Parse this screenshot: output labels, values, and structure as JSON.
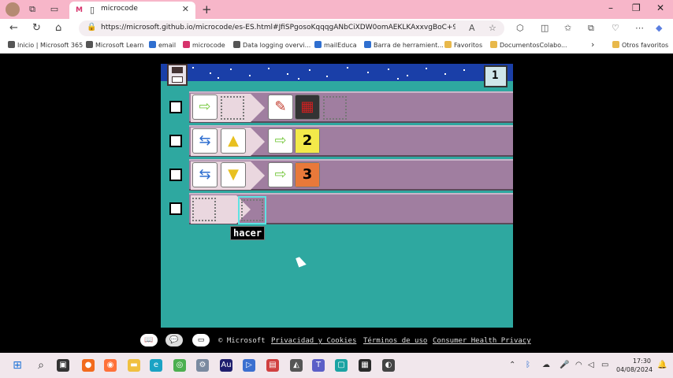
{
  "browser": {
    "tab_title": "microcode",
    "tab_favicon": "M",
    "new_tab": "+",
    "url": "https://microsoft.github.io/microcode/es-ES.html#JfiSPgosoKqqqgANbCiXDW0omAEKLKAxxvgBoC+9EACyn...",
    "window_controls": {
      "minimize": "–",
      "restore": "❐",
      "close": "✕"
    },
    "nav": {
      "back": "←",
      "reload": "↻",
      "home": "⌂"
    },
    "more": "⋯"
  },
  "bookmarks": [
    {
      "label": "Inicio | Microsoft 365",
      "color": "#555555"
    },
    {
      "label": "Microsoft Learn",
      "color": "#555555"
    },
    {
      "label": "email",
      "color": "#2f6fd0"
    },
    {
      "label": "microcode",
      "color": "#d6336c"
    },
    {
      "label": "Data logging overvi...",
      "color": "#555555"
    },
    {
      "label": "mailEduca",
      "color": "#2f6fd0"
    },
    {
      "label": "Barra de herramient...",
      "color": "#2f6fd0"
    },
    {
      "label": "Favoritos",
      "color": "#e8b84a"
    },
    {
      "label": "DocumentosColabo...",
      "color": "#e8b84a"
    },
    {
      "label": "Otros favoritos",
      "color": "#e8b84a"
    }
  ],
  "bookmarks_more": "›",
  "editor": {
    "page_number": "1",
    "tooltip": "hacer",
    "rules": [
      {
        "when": [
          "⇨",
          ""
        ],
        "do": [
          "✎",
          "▦",
          ""
        ]
      },
      {
        "when": [
          "⇆",
          "▲"
        ],
        "do": [
          "⇨",
          "2"
        ]
      },
      {
        "when": [
          "⇆",
          "▼"
        ],
        "do": [
          "⇨",
          "3"
        ]
      },
      {
        "when": [
          ""
        ],
        "do": [
          ""
        ]
      }
    ]
  },
  "footer": {
    "copyright": "© Microsoft",
    "privacy": "Privacidad y Cookies",
    "terms": "Términos de uso",
    "health": "Consumer Health Privacy"
  },
  "taskbar": {
    "time": "17:30",
    "date": "04/08/2024"
  }
}
